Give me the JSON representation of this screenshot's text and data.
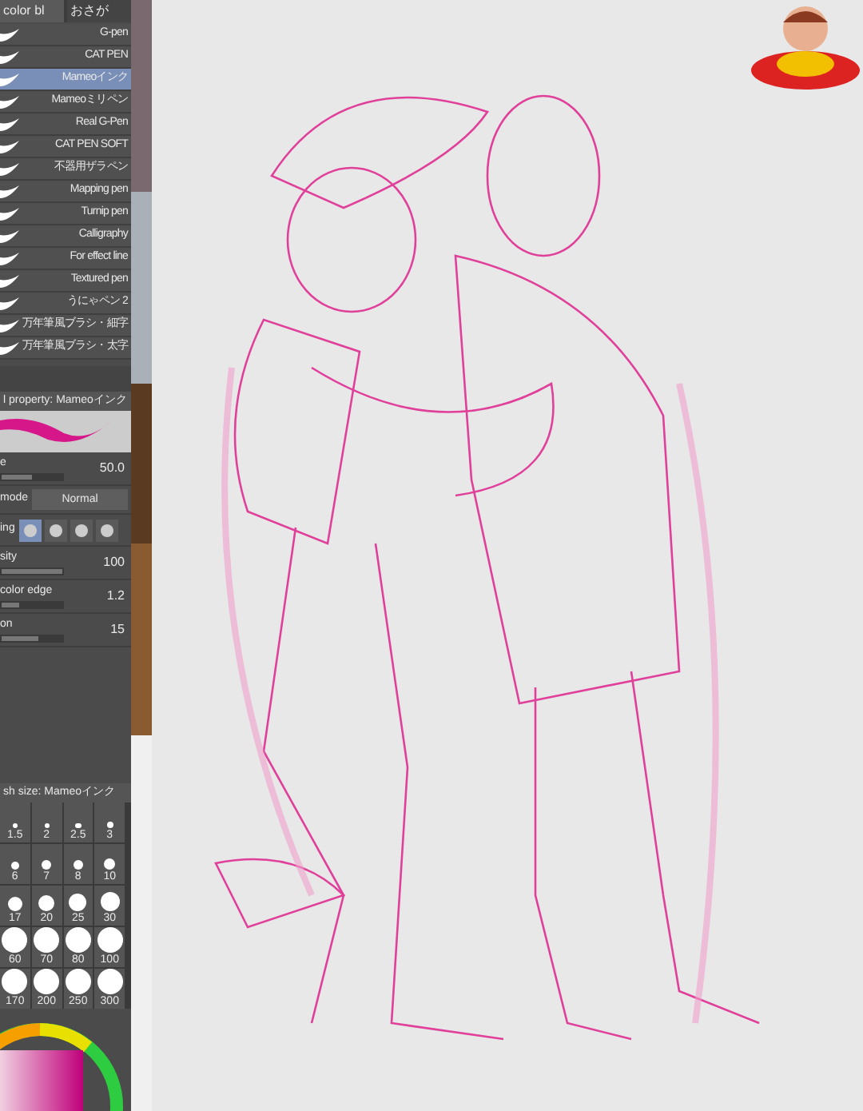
{
  "brush_tabs": [
    {
      "label": "color bl",
      "selected": true
    },
    {
      "label": "おさが",
      "selected": false
    }
  ],
  "brushes": [
    {
      "name": "G-pen",
      "selected": false
    },
    {
      "name": "CAT PEN",
      "selected": false
    },
    {
      "name": "Mameoインク",
      "selected": true
    },
    {
      "name": "Mameoミリペン",
      "selected": false
    },
    {
      "name": "Real G-Pen",
      "selected": false
    },
    {
      "name": "CAT PEN SOFT",
      "selected": false
    },
    {
      "name": "不器用ザラペン",
      "selected": false
    },
    {
      "name": "Mapping pen",
      "selected": false
    },
    {
      "name": "Turnip pen",
      "selected": false
    },
    {
      "name": "Calligraphy",
      "selected": false
    },
    {
      "name": "For effect line",
      "selected": false
    },
    {
      "name": "Textured pen",
      "selected": false
    },
    {
      "name": "うにゃペン 2",
      "selected": false
    },
    {
      "name": "万年筆風ブラシ・細字",
      "selected": false
    },
    {
      "name": "万年筆風ブラシ・太字",
      "selected": false
    }
  ],
  "tool_property": {
    "title": "l property: Mameoインク",
    "rows": [
      {
        "kind": "slider",
        "label": "e",
        "value": "50.0",
        "level": 0.5
      },
      {
        "kind": "dropdown",
        "label": "mode",
        "value": "Normal"
      },
      {
        "kind": "antialias",
        "label": "ing",
        "options": [
          {
            "selected": true
          },
          {
            "selected": false
          },
          {
            "selected": false
          },
          {
            "selected": false
          }
        ]
      },
      {
        "kind": "slider",
        "label": "sity",
        "value": "100",
        "level": 1
      },
      {
        "kind": "slider",
        "label": "color edge",
        "value": "1.2",
        "level": 0.3
      },
      {
        "kind": "slider",
        "label": "on",
        "value": "15",
        "level": 0.6
      }
    ]
  },
  "brush_size": {
    "title": "sh size: Mameoインク",
    "sizes": [
      "1.5",
      "2",
      "2.5",
      "3",
      "6",
      "7",
      "8",
      "10",
      "17",
      "20",
      "25",
      "30",
      "60",
      "70",
      "80",
      "100",
      "170",
      "200",
      "250",
      "300"
    ]
  }
}
